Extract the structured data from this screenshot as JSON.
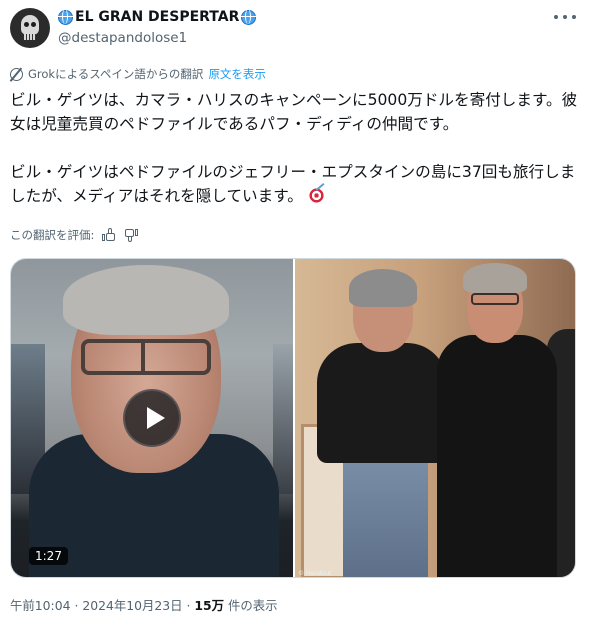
{
  "author": {
    "display_name": "EL GRAN DESPERTAR",
    "handle": "@destapandolose1",
    "avatar_icon": "punisher-skull-icon",
    "name_icon": "globe-icon"
  },
  "translation": {
    "label": "Grokによるスペイン語からの翻訳",
    "show_original": "原文を表示",
    "icon": "grok-icon"
  },
  "tweet": {
    "text": "ビル・ゲイツは、カマラ・ハリスのキャンペーンに5000万ドルを寄付します。彼女は児童売買のペドファイルであるパフ・ディディの仲間です。\n\nビル・ゲイツはペドファイルのジェフリー・エプスタインの島に37回も旅行しましたが、メディアはそれを隠しています。",
    "emoji": "direct-hit-target-emoji"
  },
  "rating": {
    "label": "この翻訳を評価:"
  },
  "media": {
    "video_duration": "1:27",
    "photo_credit": "© Handout"
  },
  "meta": {
    "time": "午前10:04",
    "separator": " · ",
    "date": "2024年10月23日",
    "views_count": "15万",
    "views_label": " 件の表示"
  },
  "colors": {
    "link": "#1d9bf0",
    "muted": "#536471",
    "text": "#0f1419",
    "border": "#cfd9de"
  }
}
